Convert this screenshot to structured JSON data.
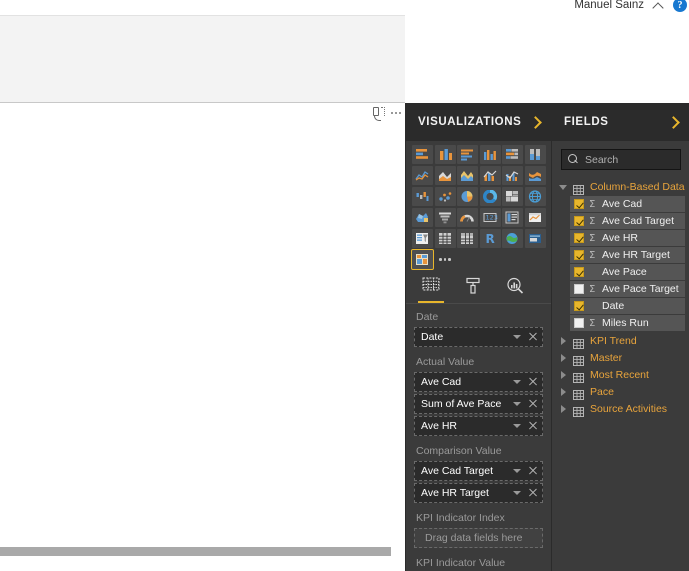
{
  "topbar": {
    "user_name": "Manuel Sainz",
    "collapse_icon": "chevron-up-icon",
    "help_icon": "help-icon",
    "help_glyph": "?"
  },
  "canvas": {
    "focus_icon": "focus-mode-icon",
    "more_options_icon": "more-options-icon"
  },
  "visualizations": {
    "title": "VISUALIZATIONS",
    "expand_icon": "chevron-right-icon",
    "gallery": [
      {
        "name": "stacked-bar-chart-icon",
        "selected": false
      },
      {
        "name": "stacked-column-chart-icon",
        "selected": false
      },
      {
        "name": "clustered-bar-chart-icon",
        "selected": false
      },
      {
        "name": "clustered-column-chart-icon",
        "selected": false
      },
      {
        "name": "hundred-percent-stacked-bar-chart-icon",
        "selected": false
      },
      {
        "name": "hundred-percent-stacked-column-chart-icon",
        "selected": false
      },
      {
        "name": "line-chart-icon",
        "selected": false
      },
      {
        "name": "area-chart-icon",
        "selected": false
      },
      {
        "name": "stacked-area-chart-icon",
        "selected": false
      },
      {
        "name": "line-and-stacked-column-chart-icon",
        "selected": false
      },
      {
        "name": "line-and-clustered-column-chart-icon",
        "selected": false
      },
      {
        "name": "ribbon-chart-icon",
        "selected": false
      },
      {
        "name": "waterfall-chart-icon",
        "selected": false
      },
      {
        "name": "scatter-chart-icon",
        "selected": false
      },
      {
        "name": "pie-chart-icon",
        "selected": false
      },
      {
        "name": "donut-chart-icon",
        "selected": false
      },
      {
        "name": "treemap-icon",
        "selected": false
      },
      {
        "name": "map-icon",
        "selected": false
      },
      {
        "name": "filled-map-icon",
        "selected": false
      },
      {
        "name": "funnel-chart-icon",
        "selected": false
      },
      {
        "name": "gauge-icon",
        "selected": false
      },
      {
        "name": "card-icon",
        "selected": false
      },
      {
        "name": "multi-row-card-icon",
        "selected": false
      },
      {
        "name": "kpi-icon",
        "selected": false
      },
      {
        "name": "slicer-icon",
        "selected": false
      },
      {
        "name": "table-icon",
        "selected": false
      },
      {
        "name": "matrix-icon",
        "selected": false
      },
      {
        "name": "r-script-visual-icon",
        "selected": false
      },
      {
        "name": "arcgis-map-icon",
        "selected": false
      },
      {
        "name": "key-influencers-icon",
        "selected": false
      },
      {
        "name": "custom-visual-icon",
        "selected": true
      }
    ],
    "more_visuals_icon": "more-visuals-icon",
    "tabs": [
      {
        "name": "fields-tab",
        "icon": "fields-grid-icon",
        "active": true
      },
      {
        "name": "format-tab",
        "icon": "paint-roller-icon",
        "active": false
      },
      {
        "name": "analytics-tab",
        "icon": "analytics-magnifier-icon",
        "active": false
      }
    ],
    "wells": [
      {
        "label": "Date",
        "items": [
          {
            "value": "Date",
            "empty": false
          }
        ]
      },
      {
        "label": "Actual Value",
        "items": [
          {
            "value": "Ave Cad",
            "empty": false
          },
          {
            "value": "Sum of Ave Pace",
            "empty": false
          },
          {
            "value": "Ave HR",
            "empty": false
          }
        ]
      },
      {
        "label": "Comparison Value",
        "items": [
          {
            "value": "Ave Cad Target",
            "empty": false
          },
          {
            "value": "Ave HR Target",
            "empty": false
          }
        ]
      },
      {
        "label": "KPI Indicator Index",
        "items": [
          {
            "value": "Drag data fields here",
            "empty": true
          }
        ]
      },
      {
        "label": "KPI Indicator Value",
        "items": []
      }
    ]
  },
  "fields": {
    "title": "FIELDS",
    "expand_icon": "chevron-right-icon",
    "search": {
      "placeholder": "Search",
      "value": "",
      "icon": "search-icon"
    },
    "tables": [
      {
        "name": "Column-Based Data",
        "expanded": true,
        "icon": "table-icon",
        "columns": [
          {
            "name": "Ave Cad",
            "checked": true,
            "aggregate": true
          },
          {
            "name": "Ave Cad Target",
            "checked": true,
            "aggregate": true
          },
          {
            "name": "Ave HR",
            "checked": true,
            "aggregate": true
          },
          {
            "name": "Ave HR Target",
            "checked": true,
            "aggregate": true
          },
          {
            "name": "Ave Pace",
            "checked": true,
            "aggregate": false
          },
          {
            "name": "Ave Pace Target",
            "checked": false,
            "aggregate": true
          },
          {
            "name": "Date",
            "checked": true,
            "aggregate": false
          },
          {
            "name": "Miles Run",
            "checked": false,
            "aggregate": true
          }
        ]
      },
      {
        "name": "KPI Trend",
        "expanded": false,
        "icon": "table-icon",
        "columns": []
      },
      {
        "name": "Master",
        "expanded": false,
        "icon": "table-icon",
        "columns": []
      },
      {
        "name": "Most Recent",
        "expanded": false,
        "icon": "table-icon",
        "columns": []
      },
      {
        "name": "Pace",
        "expanded": false,
        "icon": "table-icon",
        "columns": []
      },
      {
        "name": "Source Activities",
        "expanded": false,
        "icon": "table-icon",
        "columns": []
      }
    ]
  },
  "colors": {
    "accent": "#e8b62c",
    "table_name": "#e8a43c",
    "pane_bg": "#3b3b3b",
    "header_bg": "#2b2b2b",
    "help_blue": "#1878d0"
  }
}
